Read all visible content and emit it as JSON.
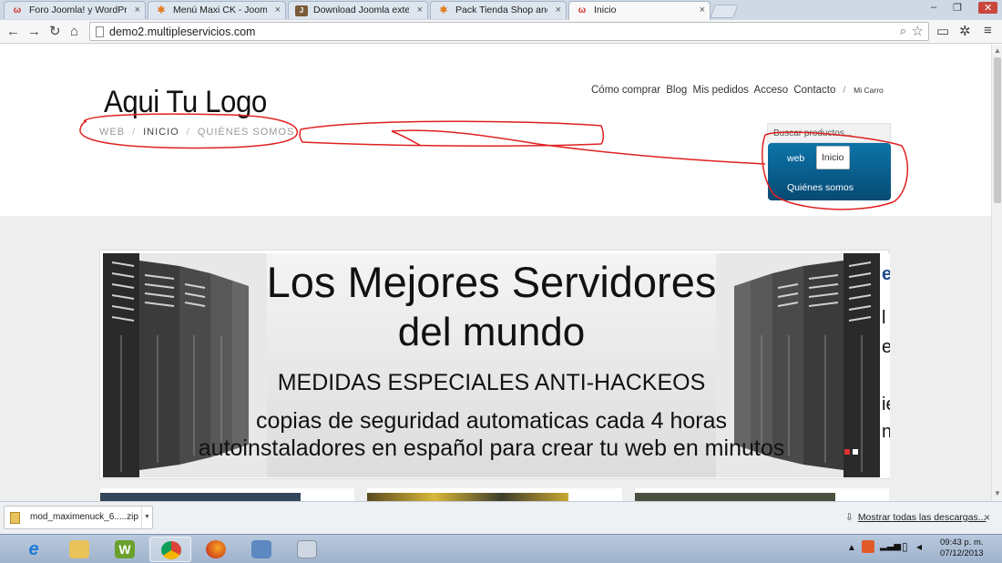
{
  "browser": {
    "tabs": [
      {
        "title": "Foro Joomla! y WordPress",
        "favicon": "w-icon"
      },
      {
        "title": "Menú Maxi CK - Joomla! E",
        "favicon": "joomla-icon"
      },
      {
        "title": "Download Joomla extensio",
        "favicon": "extension-icon"
      },
      {
        "title": "Pack Tienda Shop and Bus",
        "favicon": "joomla-icon"
      },
      {
        "title": "Inicio",
        "favicon": "w-icon"
      }
    ],
    "tab_close": "×",
    "window_controls": {
      "minimize": "–",
      "restore": "❐",
      "close": "✕"
    },
    "url": "demo2.multipleservicios.com",
    "accent": "#d42a2a"
  },
  "site": {
    "logo": "Aqui Tu Logo",
    "breadcrumb": {
      "items": [
        "WEB",
        "INICIO",
        "QUIÉNES SOMOS"
      ],
      "separator": "/"
    },
    "topnav": [
      "Cómo comprar",
      "Blog",
      "Mis pedidos",
      "Acceso",
      "Contacto"
    ],
    "topnav_separator": "/",
    "cart": "Mi Carro",
    "search_placeholder": "Buscar productos...",
    "menu": {
      "web": "web",
      "inicio": "Inicio",
      "quienes": "Quiénes somos"
    },
    "menu_color": "#0a5f8f"
  },
  "slider": {
    "line1": "Los Mejores Servidores",
    "line2": "del mundo",
    "line3": "MEDIDAS ESPECIALES ANTI-HACKEOS",
    "line4": "copias de seguridad automaticas cada 4 horas",
    "line5": "autoinstaladores en español para crear tu web en minutos",
    "next_slide_glyphs": [
      "e",
      "l",
      "e",
      "ie",
      "n"
    ],
    "dot_active_color": "#e03030"
  },
  "downloads": {
    "file": "mod_maximenuck_6.....zip",
    "show_all": "Mostrar todas las descargas...",
    "close": "×"
  },
  "taskbar": {
    "apps": [
      "internet-explorer-icon",
      "file-explorer-icon",
      "wamp-icon",
      "chrome-icon",
      "firefox-icon",
      "network-icon",
      "calculator-icon"
    ],
    "time": "09:43 p. m.",
    "date": "07/12/2013"
  }
}
